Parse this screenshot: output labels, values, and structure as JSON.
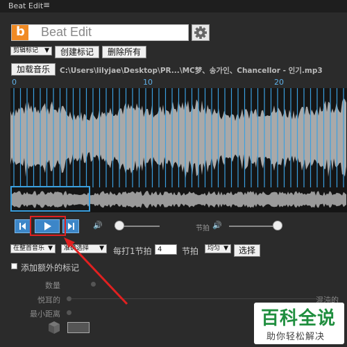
{
  "window": {
    "title": "Beat Edit",
    "menu_glyph": "≡"
  },
  "header": {
    "logo_letter": "b",
    "app_title": "Beat Edit"
  },
  "toolbar": {
    "mode_select": "剪辑标记",
    "create_label": "创建标记",
    "delete_all_label": "删除所有",
    "load_music_label": "加载音乐",
    "file_path": "C:\\Users\\lilyjae\\Desktop\\PR...\\MC梦、송가인、Chancellor - 인기.mp3"
  },
  "ruler": {
    "ticks": [
      "0",
      "10",
      "20"
    ]
  },
  "transport": {
    "volume_icon": "🔊",
    "beat_label": "节拍",
    "volume_level": 0.1,
    "beat_volume_level": 1.0
  },
  "controls": {
    "scope_select": "在整首音乐",
    "select_mode": "准确选择",
    "every_label": "每打1节拍",
    "every_value": "4",
    "beat_unit": "节拍",
    "distribution_select": "均匀",
    "select_button": "选择"
  },
  "extra": {
    "add_extra_label": "添加额外的标记",
    "count_label": "数量",
    "pleasant_label": "悦耳的",
    "chaotic_label": "混沌的",
    "min_distance_label": "最小距离"
  },
  "watermark": {
    "main": "百科全说",
    "sub": "助你轻松解决"
  },
  "colors": {
    "accent": "#3ba0e0",
    "orange": "#f08a24",
    "highlight": "#e02020"
  }
}
